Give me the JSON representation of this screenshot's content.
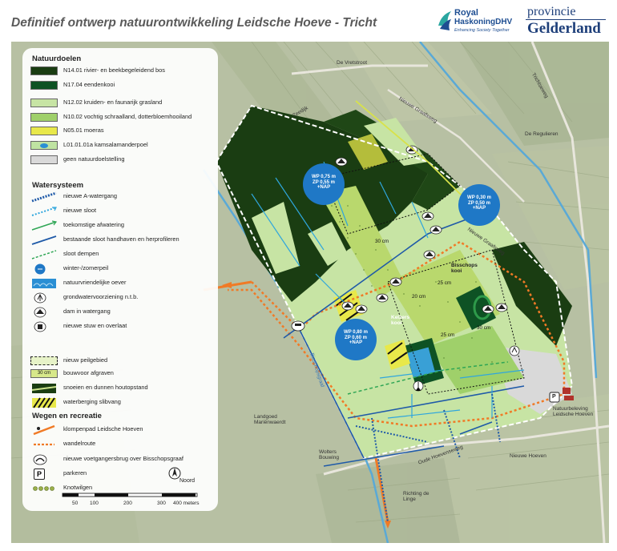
{
  "header": {
    "title": "Definitief ontwerp natuurontwikkeling Leidsche Hoeve - Tricht",
    "logo_rh": {
      "line1": "Royal",
      "line2": "HaskoningDHV",
      "tagline": "Enhancing Society Together"
    },
    "logo_pg": {
      "line1": "provincie",
      "line2": "Gelderland"
    }
  },
  "legend": {
    "natuurdoelen": {
      "heading": "Natuurdoelen",
      "items": [
        {
          "label": "N14.01 rivier- en beekbegeleidend bos",
          "color": "#1a3d12"
        },
        {
          "label": "N17.04 eendenkooi",
          "color": "#0e5224"
        },
        {
          "label": "N12.02 kruiden- en faunarijk grasland",
          "color": "#c7e4a4"
        },
        {
          "label": "N10.02 vochtig schraalland, dotterbloemhooiland",
          "color": "#9fd06a"
        },
        {
          "label": "N05.01 moeras",
          "color": "#e8e84a"
        },
        {
          "label": "L01.01.01a kamsalamanderpoel",
          "color": "#bfe3a2"
        },
        {
          "label": "geen natuurdoelstelling",
          "color": "#d9d9d9"
        }
      ]
    },
    "watersysteem": {
      "heading": "Watersysteem",
      "items": [
        {
          "label": "nieuwe A-watergang",
          "icon": "a-watergang-icon"
        },
        {
          "label": "nieuwe sloot",
          "icon": "nieuwe-sloot-icon"
        },
        {
          "label": "toekomstige afwatering",
          "icon": "afwatering-arrow-icon"
        },
        {
          "label": "bestaande sloot handhaven en herprofileren",
          "icon": "bestaande-sloot-icon"
        },
        {
          "label": "sloot dempen",
          "icon": "sloot-dempen-icon"
        },
        {
          "label": "winter-/zomerpeil",
          "icon": "wp-zp-icon"
        },
        {
          "label": "natuurvriendelijke oever",
          "icon": "oever-icon"
        },
        {
          "label": "grondwatervoorziening n.t.b.",
          "icon": "pump-icon"
        },
        {
          "label": "dam in watergang",
          "icon": "dam-icon"
        },
        {
          "label": "nieuwe stuw en overlaat",
          "icon": "stuw-icon"
        }
      ]
    },
    "overig": {
      "items": [
        {
          "label": "nieuw peilgebied",
          "icon": "peilgebied-icon"
        },
        {
          "label": "bouwvoor afgraven",
          "icon": "afgraven-icon",
          "badge": "30 cm"
        },
        {
          "label": "snoeien en dunnen houtopstand",
          "icon": "snoeien-icon"
        },
        {
          "label": "waterberging slibvang",
          "icon": "slibvang-icon"
        }
      ]
    },
    "wegen": {
      "heading": "Wegen en recreatie",
      "items": [
        {
          "label": "klompenpad Leidsche Hoeven",
          "icon": "klompenpad-icon"
        },
        {
          "label": "wandelroute",
          "icon": "wandelroute-icon"
        },
        {
          "label": "nieuwe voetgangersbrug over Bisschopsgraaf",
          "icon": "brug-icon"
        },
        {
          "label": "parkeren",
          "icon": "parking-icon",
          "symbol": "P"
        },
        {
          "label": "Knotwilgen",
          "icon": "knotwilgen-icon"
        }
      ]
    },
    "scale": {
      "ticks": [
        "50",
        "100",
        "200",
        "300",
        "400 meters"
      ]
    },
    "north": "Noord"
  },
  "map": {
    "roads": {
      "vretstroot": "De Vretstroot",
      "trichtseweg": "Trichtseweg",
      "graafsweg": "Nieuwe Graafsweg",
      "regulieren": "De Regulieren",
      "zeedijk": "Zeedijk",
      "bisschopsgraaf": "Bisschopsgraaf",
      "hoevenseweg": "Oude Hoevenseweg",
      "nieuwe_hoeven": "Nieuwe Hoeven"
    },
    "places": {
      "landgoed": "Landgoed Mariënwaerdt",
      "wolters": "Wolters Bouwing",
      "bisschops_kooi": "Bisschops kooi",
      "kelzers_kooi": "Kelzers kooi",
      "natuurbeleving": "Natuurbeleving Leidsche Hoeven",
      "richting": "Richting de Linge"
    },
    "peil": [
      {
        "wp": "WP 0,75 m",
        "zp": "ZP 0,55  m",
        "nap": "+NAP"
      },
      {
        "wp": "WP 0,30 m",
        "zp": "ZP 0,50 m",
        "nap": "+NAP"
      },
      {
        "wp": "WP 0,80 m",
        "zp": "ZP 0,60 m",
        "nap": "+NAP"
      }
    ],
    "depths": [
      "30 cm",
      "25 cm",
      "20 cm",
      "25 cm",
      "30 cm"
    ],
    "parking": "P"
  }
}
